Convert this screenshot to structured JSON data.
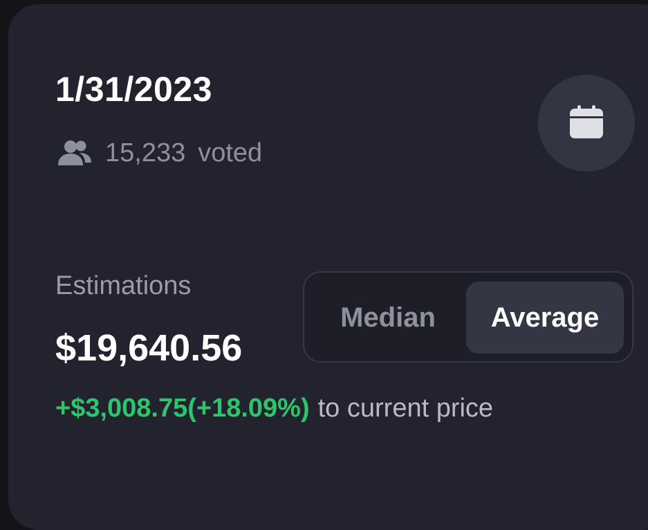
{
  "header": {
    "date": "1/31/2023",
    "voted_count": "15,233",
    "voted_label": "voted",
    "users_icon": "users-icon",
    "calendar_icon": "calendar-icon"
  },
  "estimations": {
    "label": "Estimations",
    "value": "$19,640.56",
    "change": "+$3,008.75(+18.09%)",
    "change_suffix": "to current price",
    "change_color": "#2dc46a"
  },
  "toggle": {
    "options": [
      {
        "label": "Median",
        "selected": false
      },
      {
        "label": "Average",
        "selected": true
      }
    ]
  },
  "colors": {
    "background": "#22232e",
    "positive": "#2dc46a"
  }
}
